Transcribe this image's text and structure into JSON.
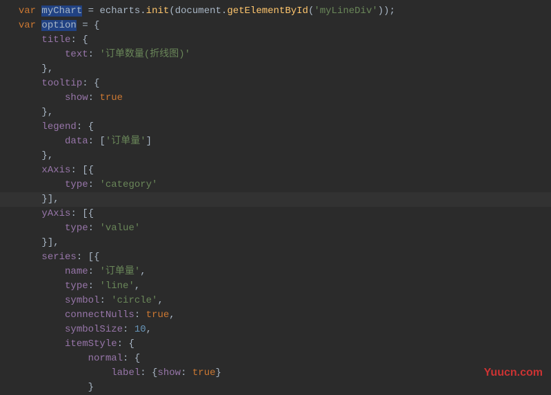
{
  "code": {
    "l1": {
      "var": "var ",
      "v": "myChart",
      "sp": " ",
      "eq": "= ",
      "e": "echarts",
      "dot": ".",
      "fn": "init",
      "op": "(",
      "d": "document",
      "dot2": ".",
      "fn2": "getElementById",
      "op2": "(",
      "s": "'myLineDiv'",
      "cl": "));"
    },
    "l2": {
      "var": "var ",
      "v": "option",
      "sp": " ",
      "eq": "= {"
    },
    "l3": {
      "p": "title",
      "c": ": {"
    },
    "l4": {
      "p": "text",
      "c": ": ",
      "s": "'订单数量(折线图)'"
    },
    "l5": {
      "b": "},"
    },
    "l6": {
      "p": "tooltip",
      "c": ": {"
    },
    "l7": {
      "p": "show",
      "c": ": ",
      "v": "true"
    },
    "l8": {
      "b": "},"
    },
    "l9": {
      "p": "legend",
      "c": ": {"
    },
    "l10": {
      "p": "data",
      "c": ": [",
      "s": "'订单量'",
      "cl": "]"
    },
    "l11": {
      "b": "},"
    },
    "l12": {
      "p": "xAxis",
      "c": ": [{"
    },
    "l13": {
      "p": "type",
      "c": ": ",
      "s": "'category'"
    },
    "l14": {
      "b": "}],"
    },
    "l15": {
      "p": "yAxis",
      "c": ": [{"
    },
    "l16": {
      "p": "type",
      "c": ": ",
      "s": "'value'"
    },
    "l17": {
      "b": "}],"
    },
    "l18": {
      "p": "series",
      "c": ": [{"
    },
    "l19": {
      "p": "name",
      "c": ": ",
      "s": "'订单量'",
      "cm": ","
    },
    "l20": {
      "p": "type",
      "c": ": ",
      "s": "'line'",
      "cm": ","
    },
    "l21": {
      "p": "symbol",
      "c": ": ",
      "s": "'circle'",
      "cm": ","
    },
    "l22": {
      "p": "connectNulls",
      "c": ": ",
      "v": "true",
      "cm": ","
    },
    "l23": {
      "p": "symbolSize",
      "c": ": ",
      "n": "10",
      "cm": ","
    },
    "l24": {
      "p": "itemStyle",
      "c": ": {"
    },
    "l25": {
      "p": "normal",
      "c": ": {"
    },
    "l26": {
      "p": "label",
      "c": ": {",
      "p2": "show",
      "c2": ": ",
      "v": "true",
      "cl": "}"
    },
    "l27": {
      "b": "}"
    }
  },
  "watermark": "Yuucn.com"
}
